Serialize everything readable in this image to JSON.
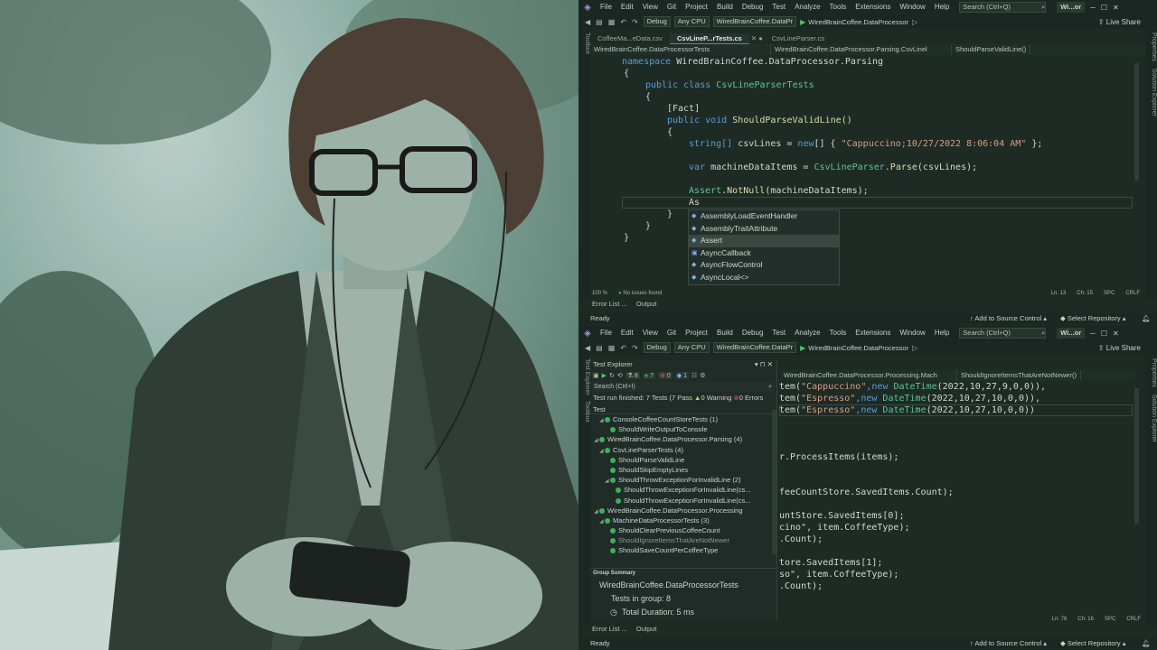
{
  "top_window": {
    "menu": [
      "File",
      "Edit",
      "View",
      "Git",
      "Project",
      "Build",
      "Debug",
      "Test",
      "Analyze",
      "Tools",
      "Extensions",
      "Window",
      "Help"
    ],
    "search_placeholder": "Search (Ctrl+Q)",
    "solution_badge": "Wi...or",
    "toolbar": {
      "config": "Debug",
      "platform": "Any CPU",
      "startup_project": "WiredBrainCoffee.DataPr",
      "run_target": "WiredBrainCoffee.DataProcessor",
      "live_share": "Live Share"
    },
    "tabs": [
      "CoffeeMa...eData.csv",
      "CsvLineP...rTests.cs",
      "CsvLineParser.cs"
    ],
    "navbar": [
      "WiredBrainCoffee.DataProcessorTests",
      "WiredBrainCoffee.DataProcessor.Parsing.CsvLinel",
      "ShouldParseValidLine()"
    ],
    "code": {
      "namespace_kw": "namespace",
      "namespace_name": "WiredBrainCoffee.DataProcessor.Parsing",
      "open_brace": "{",
      "close_brace": "}",
      "public": "public",
      "class": "class",
      "class_name": "CsvLineParserTests",
      "attr_fact": "[Fact]",
      "void": "void",
      "method_sig": "ShouldParseValidLine()",
      "line1_type": "string[]",
      "line1_rest": " csvLines = ",
      "line1_new": "new",
      "line1_arr": "[] { ",
      "line1_str": "\"Cappuccino;10/27/2022 8:06:04 AM\"",
      "line1_end": " };",
      "line2_var": "var",
      "line2_rest": " machineDataItems = ",
      "line2_type": "CsvLineParser",
      "line2_dot": ".",
      "line2_fn": "Parse",
      "line2_end": "(csvLines);",
      "line3_type": "Assert",
      "line3_dot": ".",
      "line3_fn": "NotNull",
      "line3_end": "(machineDataItems);",
      "typing": "As"
    },
    "intellisense": [
      {
        "icon": "class-icon",
        "label": "AssemblyLoadEventHandler"
      },
      {
        "icon": "class-icon",
        "label": "AssemblyTraitAttribute"
      },
      {
        "icon": "class-icon",
        "label": "Assert",
        "selected": true
      },
      {
        "icon": "delegate-icon",
        "label": "AsyncCallback"
      },
      {
        "icon": "class-icon",
        "label": "AsyncFlowControl"
      },
      {
        "icon": "class-icon",
        "label": "AsyncLocal<>"
      }
    ],
    "status": {
      "zoom": "100 %",
      "issues": "No issues found",
      "ln": "Ln: 13",
      "ch": "Ch: 15",
      "spc": "SPC",
      "crlf": "CRLF"
    },
    "panels": [
      "Error List ...",
      "Output"
    ],
    "statusbar": {
      "ready": "Ready",
      "source_control": "Add to Source Control",
      "repo": "Select Repository"
    }
  },
  "bottom_window": {
    "menu": [
      "File",
      "Edit",
      "View",
      "Git",
      "Project",
      "Build",
      "Debug",
      "Test",
      "Analyze",
      "Tools",
      "Extensions",
      "Window",
      "Help"
    ],
    "search_placeholder": "Search (Ctrl+Q)",
    "solution_badge": "Wi...or",
    "toolbar": {
      "config": "Debug",
      "platform": "Any CPU",
      "startup_project": "WiredBrainCoffee.DataPr",
      "run_target": "WiredBrainCoffee.DataProcessor",
      "live_share": "Live Share"
    },
    "test_explorer": {
      "title": "Test Explorer",
      "counts": {
        "total": "8",
        "passed": "7",
        "failed": "0",
        "not_run": "1"
      },
      "search_placeholder": "Search (Ctrl+I)",
      "summary": "Test run finished: 7 Tests (7 Pass",
      "warnings": "0 Warning",
      "errors": "0 Errors",
      "column": "Test",
      "tree": [
        {
          "label": "ConsoleCoffeeCountStoreTests (1)",
          "indent": 1,
          "arrow": true
        },
        {
          "label": "ShouldWriteOutputToConsole",
          "indent": 2
        },
        {
          "label": "WiredBrainCoffee.DataProcessor.Parsing (4)",
          "indent": 0,
          "arrow": true
        },
        {
          "label": "CsvLineParserTests (4)",
          "indent": 1,
          "arrow": true
        },
        {
          "label": "ShouldParseValidLine",
          "indent": 2
        },
        {
          "label": "ShouldSkipEmptyLines",
          "indent": 2
        },
        {
          "label": "ShouldThrowExceptionForInvalidLine (2)",
          "indent": 2,
          "arrow": true
        },
        {
          "label": "ShouldThrowExceptionForInvalidLine(cs...",
          "indent": 3
        },
        {
          "label": "ShouldThrowExceptionForInvalidLine(cs...",
          "indent": 3
        },
        {
          "label": "WiredBrainCoffee.DataProcessor.Processing",
          "indent": 0,
          "arrow": true
        },
        {
          "label": "MachineDataProcessorTests (3)",
          "indent": 1,
          "arrow": true
        },
        {
          "label": "ShouldClearPreviousCoffeeCount",
          "indent": 2
        },
        {
          "label": "ShouldIgnoreItemsThatAreNotNewer",
          "indent": 2,
          "dim": true
        },
        {
          "label": "ShouldSaveCountPerCoffeeType",
          "indent": 2
        }
      ],
      "group_summary_title": "Group Summary",
      "group_name": "WiredBrainCoffee.DataProcessorTests",
      "tests_in_group": "Tests in group: 8",
      "total_duration": "Total Duration: 5 ms"
    },
    "navbar": [
      "WiredBrainCoffee.DataProcessor.Processing.Mach",
      "ShouldIgnoreItemsThatAreNotNewer()"
    ],
    "code_lines": [
      [
        "tem(",
        "\"Cappuccino\"",
        ",new ",
        "DateTime",
        "(2022,10,27,9,0,0)),"
      ],
      [
        "tem(",
        "\"Espresso\"",
        ",new ",
        "DateTime",
        "(2022,10,27,10,0,0)),"
      ],
      [
        "tem(",
        "\"Espresso\"",
        ",new ",
        "DateTime",
        "(2022,10,27,10,0,0))"
      ],
      [
        "r.ProcessItems(items);"
      ],
      [
        "feeCountStore.SavedItems.Count);"
      ],
      [
        "untStore.SavedItems[0];"
      ],
      [
        "cino\", item.CoffeeType);"
      ],
      [
        ".Count);"
      ],
      [
        "tore.SavedItems[1];"
      ],
      [
        "so\", item.CoffeeType);"
      ],
      [
        ".Count);"
      ]
    ],
    "status": {
      "ln": "Ln: 76",
      "ch": "Ch: 16",
      "spc": "SPC",
      "crlf": "CRLF"
    },
    "panels": [
      "Error List ...",
      "Output"
    ],
    "statusbar": {
      "ready": "Ready",
      "source_control": "Add to Source Control",
      "repo": "Select Repository"
    }
  },
  "side_labels": {
    "toolbox": "Toolbox",
    "test_explorer": "Test Explorer",
    "properties": "Properties",
    "solution_explorer": "Solution Explorer"
  }
}
